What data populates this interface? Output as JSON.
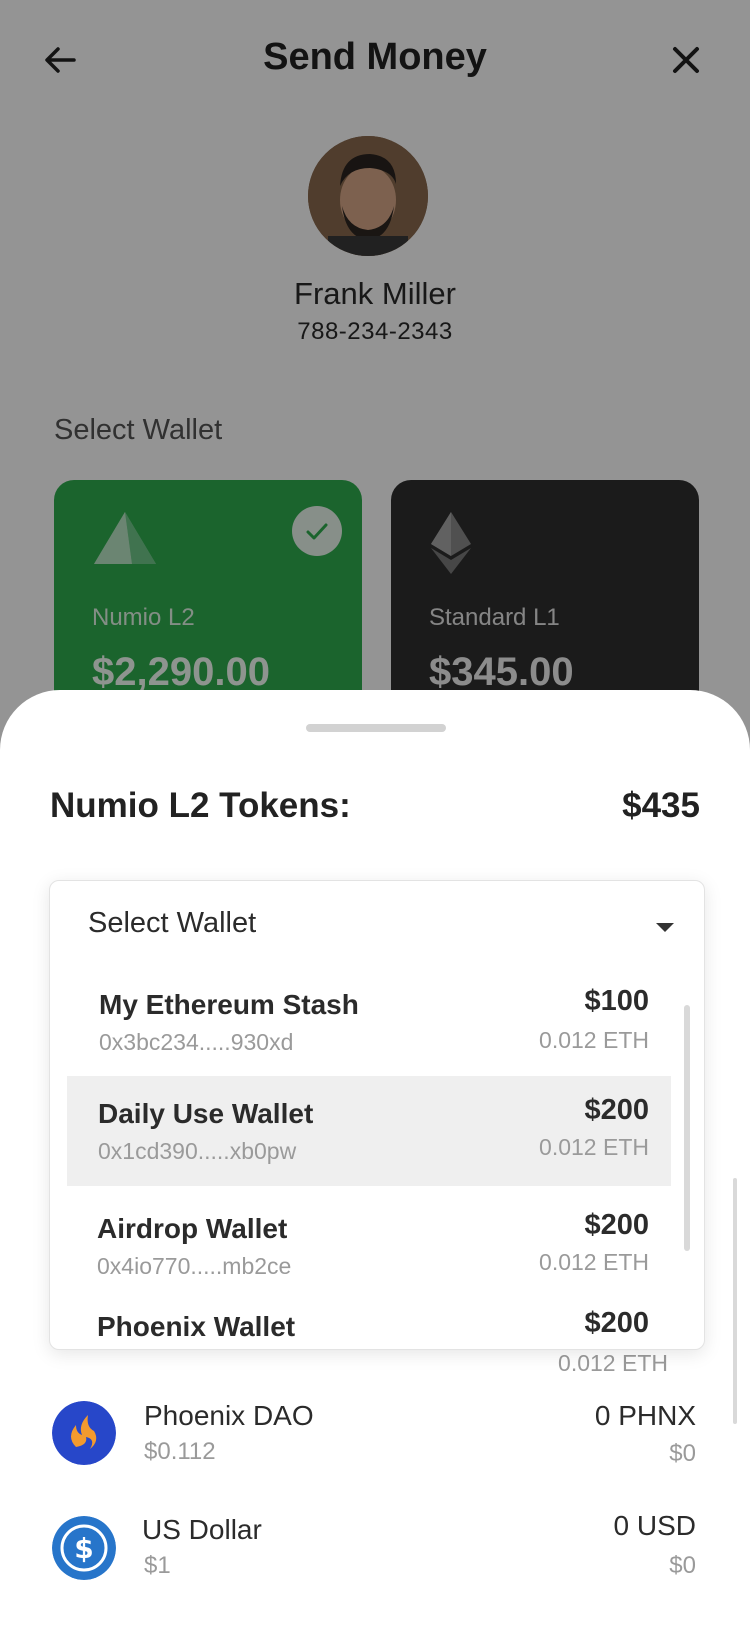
{
  "header": {
    "title": "Send Money",
    "back_icon": "arrow-left-icon",
    "close_icon": "close-icon"
  },
  "recipient": {
    "name": "Frank Miller",
    "phone": "788-234-2343"
  },
  "wallets_section": {
    "label": "Select Wallet",
    "cards": [
      {
        "name": "Numio L2",
        "amount": "$2,290.00",
        "icon": "numio-triangle-icon",
        "selected": true,
        "color": "#2fad4f"
      },
      {
        "name": "Standard L1",
        "amount": "$345.00",
        "icon": "ethereum-icon",
        "selected": false,
        "color": "#303030"
      }
    ]
  },
  "sheet": {
    "title": "Numio L2 Tokens:",
    "total": "$435",
    "dropdown": {
      "label": "Select Wallet",
      "items": [
        {
          "name": "My Ethereum Stash",
          "address": "0x3bc234.....930xd",
          "usd": "$100",
          "eth": "0.012 ETH"
        },
        {
          "name": "Daily Use Wallet",
          "address": "0x1cd390.....xb0pw",
          "usd": "$200",
          "eth": "0.012 ETH"
        },
        {
          "name": "Airdrop Wallet",
          "address": "0x4io770.....mb2ce",
          "usd": "$200",
          "eth": "0.012 ETH"
        },
        {
          "name": "Phoenix Wallet",
          "usd": "$200",
          "eth": "0.012 ETH"
        }
      ]
    },
    "tokens": [
      {
        "name": "Phoenix DAO",
        "price": "$0.112",
        "amount": "0 PHNX",
        "value": "$0",
        "icon": "phoenix-dao-icon"
      },
      {
        "name": "US Dollar",
        "price": "$1",
        "amount": "0 USD",
        "value": "$0",
        "icon": "usd-coin-icon"
      }
    ]
  }
}
